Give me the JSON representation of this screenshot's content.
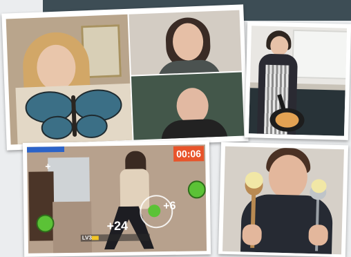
{
  "game": {
    "timer": "00:06",
    "score_right": "+6",
    "score_center": "+24",
    "level": "LV3",
    "score_left": "+"
  },
  "colors": {
    "banner": "#3d4d55",
    "timer_bg": "#e8542a",
    "target_green": "#5bc236",
    "photo_border": "#ffffff"
  }
}
